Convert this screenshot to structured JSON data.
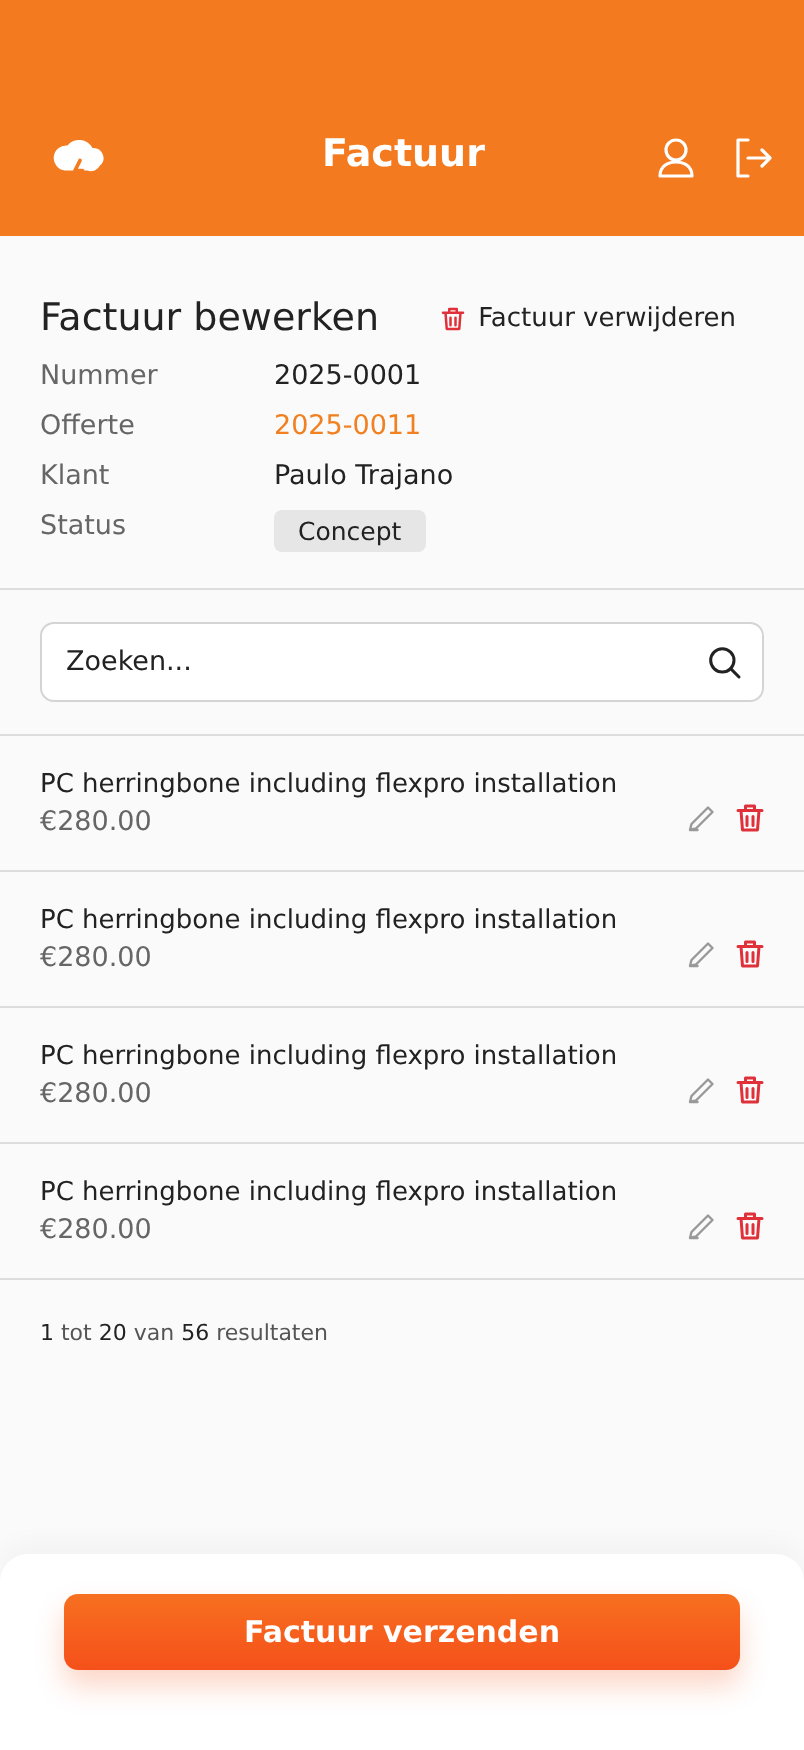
{
  "header": {
    "title": "Factuur"
  },
  "details": {
    "title": "Factuur bewerken",
    "delete_label": "Factuur verwijderen",
    "fields": [
      {
        "label": "Nummer",
        "value": "2025-0001",
        "kind": "text"
      },
      {
        "label": "Offerte",
        "value": "2025-0011",
        "kind": "link"
      },
      {
        "label": "Klant",
        "value": "Paulo Trajano",
        "kind": "text"
      },
      {
        "label": "Status",
        "value": "Concept",
        "kind": "badge"
      }
    ]
  },
  "search": {
    "placeholder": "Zoeken..."
  },
  "items": [
    {
      "name": "PC herringbone including flexpro installation",
      "price": "€280.00"
    },
    {
      "name": "PC herringbone including flexpro installation",
      "price": "€280.00"
    },
    {
      "name": "PC herringbone including flexpro installation",
      "price": "€280.00"
    },
    {
      "name": "PC herringbone including flexpro installation",
      "price": "€280.00"
    }
  ],
  "pagination": "**1** tot **20** van **56** resultaten",
  "footer": {
    "button": "Factuur verzenden"
  }
}
